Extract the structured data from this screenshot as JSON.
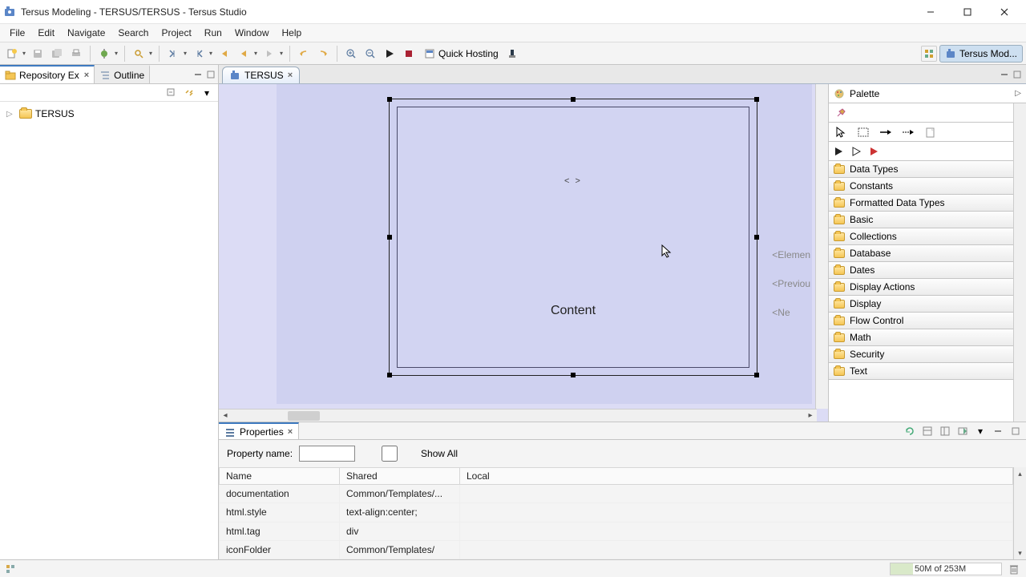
{
  "window": {
    "title": "Tersus Modeling - TERSUS/TERSUS - Tersus Studio"
  },
  "menu": {
    "items": [
      "File",
      "Edit",
      "Navigate",
      "Search",
      "Project",
      "Run",
      "Window",
      "Help"
    ]
  },
  "toolbar": {
    "quick_hosting": "Quick Hosting",
    "perspective": "Tersus Mod..."
  },
  "left_panel": {
    "tab_repo": "Repository Ex",
    "tab_outline": "Outline",
    "tree_root": "TERSUS"
  },
  "editor": {
    "tab": "TERSUS",
    "content_label": "Content",
    "side1": "<Elemen",
    "side2": "<Previou",
    "side3": "<Ne"
  },
  "palette": {
    "title": "Palette",
    "cats": [
      "Data Types",
      "Constants",
      "Formatted Data Types",
      "Basic",
      "Collections",
      "Database",
      "Dates",
      "Display Actions",
      "Display",
      "Flow Control",
      "Math",
      "Security",
      "Text"
    ]
  },
  "properties": {
    "tab": "Properties",
    "filter_label": "Property name:",
    "show_all": "Show All",
    "cols": [
      "Name",
      "Shared",
      "Local"
    ],
    "rows": [
      {
        "name": "documentation",
        "shared": "Common/Templates/...",
        "local": ""
      },
      {
        "name": "html.style",
        "shared": "text-align:center;",
        "local": ""
      },
      {
        "name": "html.tag",
        "shared": "div",
        "local": ""
      },
      {
        "name": "iconFolder",
        "shared": "Common/Templates/",
        "local": ""
      }
    ]
  },
  "status": {
    "heap": "50M of 253M"
  }
}
